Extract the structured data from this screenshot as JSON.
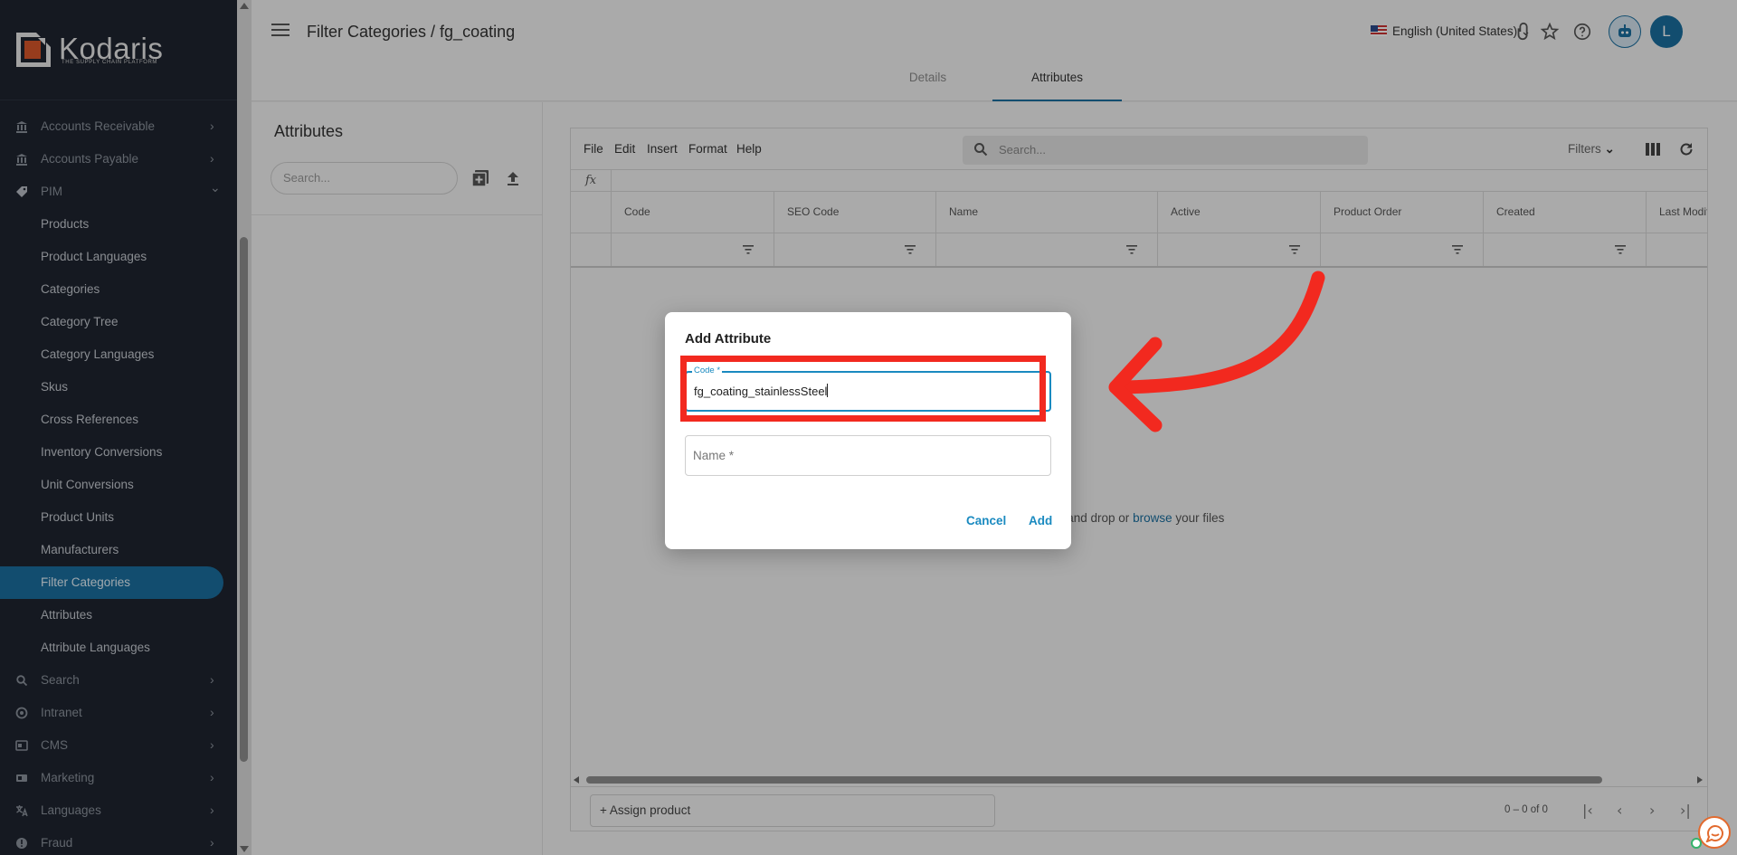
{
  "app": {
    "brand": "Kodaris",
    "tagline": "THE SUPPLY CHAIN PLATFORM"
  },
  "sidebar": {
    "items": [
      {
        "label": "Accounts Receivable",
        "icon": "bank-icon",
        "chevron": "›"
      },
      {
        "label": "Accounts Payable",
        "icon": "bank-icon",
        "chevron": "›"
      },
      {
        "label": "PIM",
        "icon": "tag-icon",
        "chevron": "⌄"
      },
      {
        "label": "Products"
      },
      {
        "label": "Product Languages"
      },
      {
        "label": "Categories"
      },
      {
        "label": "Category Tree"
      },
      {
        "label": "Category Languages"
      },
      {
        "label": "Skus"
      },
      {
        "label": "Cross References"
      },
      {
        "label": "Inventory Conversions"
      },
      {
        "label": "Unit Conversions"
      },
      {
        "label": "Product Units"
      },
      {
        "label": "Manufacturers"
      },
      {
        "label": "Filter Categories",
        "active": true
      },
      {
        "label": "Attributes"
      },
      {
        "label": "Attribute Languages"
      },
      {
        "label": "Search",
        "icon": "search-icon",
        "chevron": "›"
      },
      {
        "label": "Intranet",
        "icon": "intranet-icon",
        "chevron": "›"
      },
      {
        "label": "CMS",
        "icon": "cms-icon",
        "chevron": "›"
      },
      {
        "label": "Marketing",
        "icon": "marketing-icon",
        "chevron": "›"
      },
      {
        "label": "Languages",
        "icon": "translate-icon",
        "chevron": "›"
      },
      {
        "label": "Fraud",
        "icon": "alert-icon",
        "chevron": "›"
      }
    ]
  },
  "header": {
    "breadcrumb": "Filter Categories / fg_coating",
    "language": "English (United States)",
    "language_chevron": "⌄",
    "avatar_initial": "L",
    "tabs": [
      {
        "label": "Details"
      },
      {
        "label": "Attributes",
        "active": true
      }
    ]
  },
  "left_panel": {
    "title": "Attributes",
    "search_placeholder": "Search..."
  },
  "sheet": {
    "menu": [
      "File",
      "Edit",
      "Insert",
      "Format",
      "Help"
    ],
    "search_placeholder": "Search...",
    "filters_label": "Filters",
    "fx_label": "fx",
    "columns": [
      "Code",
      "SEO Code",
      "Name",
      "Active",
      "Product Order",
      "Created",
      "Last Modifi"
    ],
    "drop_text_before": "g and drop or ",
    "drop_link": "browse",
    "drop_text_after": " your files",
    "assign_product": "+ Assign product",
    "pager": "0 – 0 of 0",
    "pager_buttons": [
      "|‹",
      "‹",
      "›",
      "›|"
    ]
  },
  "dialog": {
    "title": "Add Attribute",
    "code_label": "Code *",
    "code_value": "fg_coating_stainlessSteel",
    "name_placeholder": "Name *",
    "cancel_label": "Cancel",
    "add_label": "Add"
  },
  "colors": {
    "accent": "#1a6fa0",
    "sidebar_bg": "#1f2530",
    "highlight": "#f2291f"
  }
}
